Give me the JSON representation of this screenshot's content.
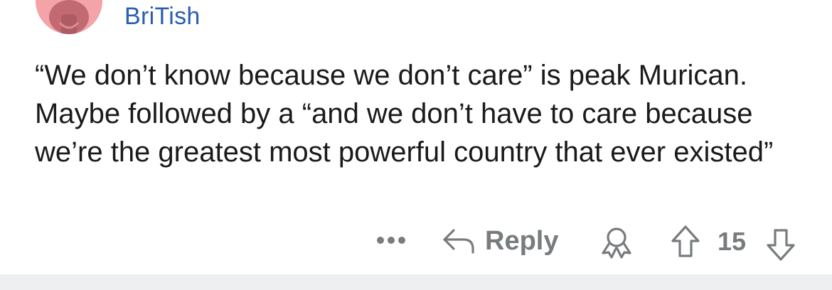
{
  "comment": {
    "author": "BriTish",
    "body": "“We don’t know because we don’t care” is peak Murican. Maybe followed by a “and we don’t have to care because we’re the greatest most powerful country that ever existed”",
    "avatar_icon": "snoo-avatar-icon",
    "avatar_color": "#f4a3a8"
  },
  "actions": {
    "more_icon": "more-dots-icon",
    "reply_icon": "reply-arrow-icon",
    "reply_label": "Reply",
    "award_icon": "award-icon",
    "upvote_icon": "upvote-arrow-icon",
    "score": "15",
    "downvote_icon": "downvote-arrow-icon"
  },
  "colors": {
    "username": "#2a5db0",
    "body_text": "#1a1a1b",
    "action_gray": "#787c7e",
    "divider": "#edeff1"
  }
}
